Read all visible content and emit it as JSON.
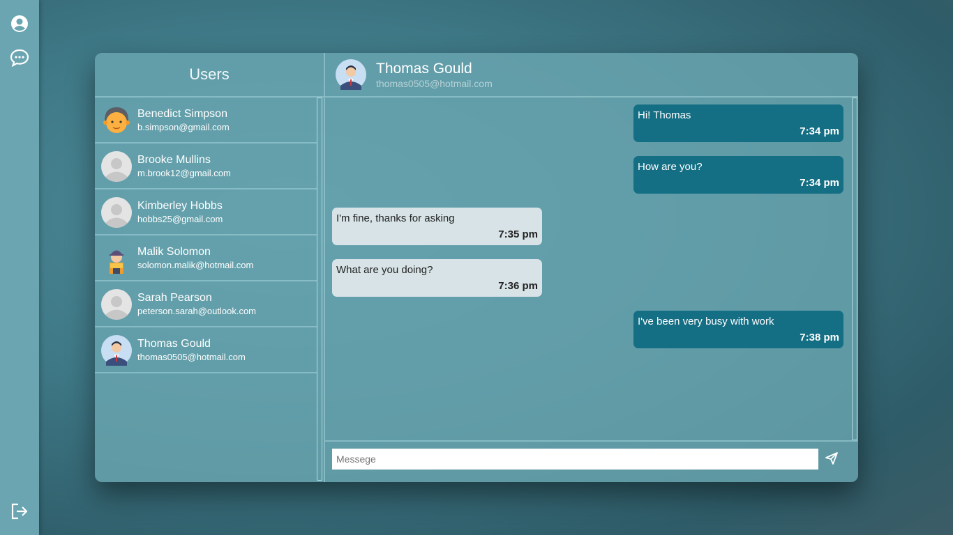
{
  "rail": {
    "icons": [
      "user-circle-icon",
      "chat-bubble-icon",
      "logout-icon"
    ]
  },
  "users_panel": {
    "title": "Users",
    "users": [
      {
        "name": "Benedict Simpson",
        "email": "b.simpson@gmail.com",
        "avatar": "bald-man-avatar"
      },
      {
        "name": "Brooke Mullins",
        "email": "m.brook12@gmail.com",
        "avatar": "default-avatar"
      },
      {
        "name": "Kimberley Hobbs",
        "email": "hobbs25@gmail.com",
        "avatar": "default-avatar"
      },
      {
        "name": "Malik Solomon",
        "email": "solomon.malik@hotmail.com",
        "avatar": "worker-avatar"
      },
      {
        "name": "Sarah Pearson",
        "email": "peterson.sarah@outlook.com",
        "avatar": "default-avatar"
      },
      {
        "name": "Thomas Gould",
        "email": "thomas0505@hotmail.com",
        "avatar": "businessman-avatar"
      }
    ]
  },
  "chat": {
    "contact_name": "Thomas Gould",
    "contact_email": "thomas0505@hotmail.com",
    "messages": [
      {
        "text": "Hi! Thomas",
        "time": "7:34 pm",
        "direction": "sent"
      },
      {
        "text": "How are you?",
        "time": "7:34 pm",
        "direction": "sent"
      },
      {
        "text": "I'm fine, thanks for asking",
        "time": "7:35 pm",
        "direction": "received"
      },
      {
        "text": "What are you doing?",
        "time": "7:36 pm",
        "direction": "received"
      },
      {
        "text": "I've been very busy with work",
        "time": "7:38 pm",
        "direction": "sent"
      }
    ],
    "input_placeholder": "Messege",
    "input_value": ""
  },
  "colors": {
    "sent_bubble": "#146e84",
    "received_bubble": "#d7e3e7",
    "rail": "#6aa5b1"
  }
}
